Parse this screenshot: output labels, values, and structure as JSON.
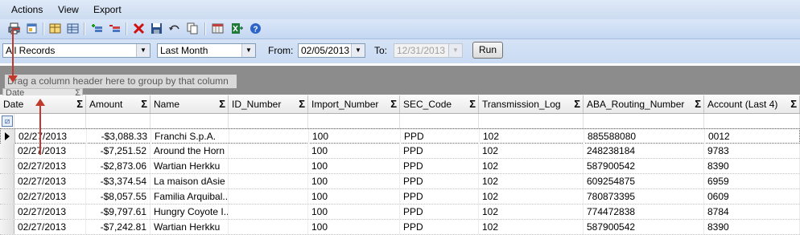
{
  "menu": [
    "Actions",
    "View",
    "Export"
  ],
  "toolbar": {
    "icons": [
      "print-icon",
      "print-preview-icon",
      "grid-icon",
      "table-icon",
      "add-row-icon",
      "remove-row-icon",
      "delete-icon",
      "save-icon",
      "undo-icon",
      "copy-icon",
      "calculator-icon",
      "excel-export-icon",
      "help-icon"
    ]
  },
  "filters": {
    "records_value": "All Records",
    "period_value": "Last Month",
    "from_label": "From:",
    "from_value": "02/05/2013",
    "to_label": "To:",
    "to_value": "12/31/2013",
    "run_label": "Run"
  },
  "group_panel": {
    "hint": "Drag a column header here to group by that column",
    "dragging_column": "Date"
  },
  "grid": {
    "columns": [
      "Date",
      "Amount",
      "Name",
      "ID_Number",
      "Import_Number",
      "SEC_Code",
      "Transmission_Log",
      "ABA_Routing_Number",
      "Account (Last 4)"
    ],
    "rows": [
      [
        "02/27/2013",
        "-$3,088.33",
        "Franchi S.p.A.",
        "",
        "100",
        "PPD",
        "102",
        "885588080",
        "0012"
      ],
      [
        "02/27/2013",
        "-$7,251.52",
        "Around the Horn",
        "",
        "100",
        "PPD",
        "102",
        "248238184",
        "9783"
      ],
      [
        "02/27/2013",
        "-$2,873.06",
        "Wartian Herkku",
        "",
        "100",
        "PPD",
        "102",
        "587900542",
        "8390"
      ],
      [
        "02/27/2013",
        "-$3,374.54",
        "La maison dAsie",
        "",
        "100",
        "PPD",
        "102",
        "609254875",
        "6959"
      ],
      [
        "02/27/2013",
        "-$8,057.55",
        "Familia Arquibal...",
        "",
        "100",
        "PPD",
        "102",
        "780873395",
        "0609"
      ],
      [
        "02/27/2013",
        "-$9,797.61",
        "Hungry Coyote I...",
        "",
        "100",
        "PPD",
        "102",
        "774472838",
        "8784"
      ],
      [
        "02/27/2013",
        "-$7,242.81",
        "Wartian Herkku",
        "",
        "100",
        "PPD",
        "102",
        "587900542",
        "8390"
      ]
    ]
  },
  "colors": {
    "menu_bg": "#dfe9f7",
    "group_panel_bg": "#8c8c8c",
    "annotation_arrow": "#c0392b"
  }
}
